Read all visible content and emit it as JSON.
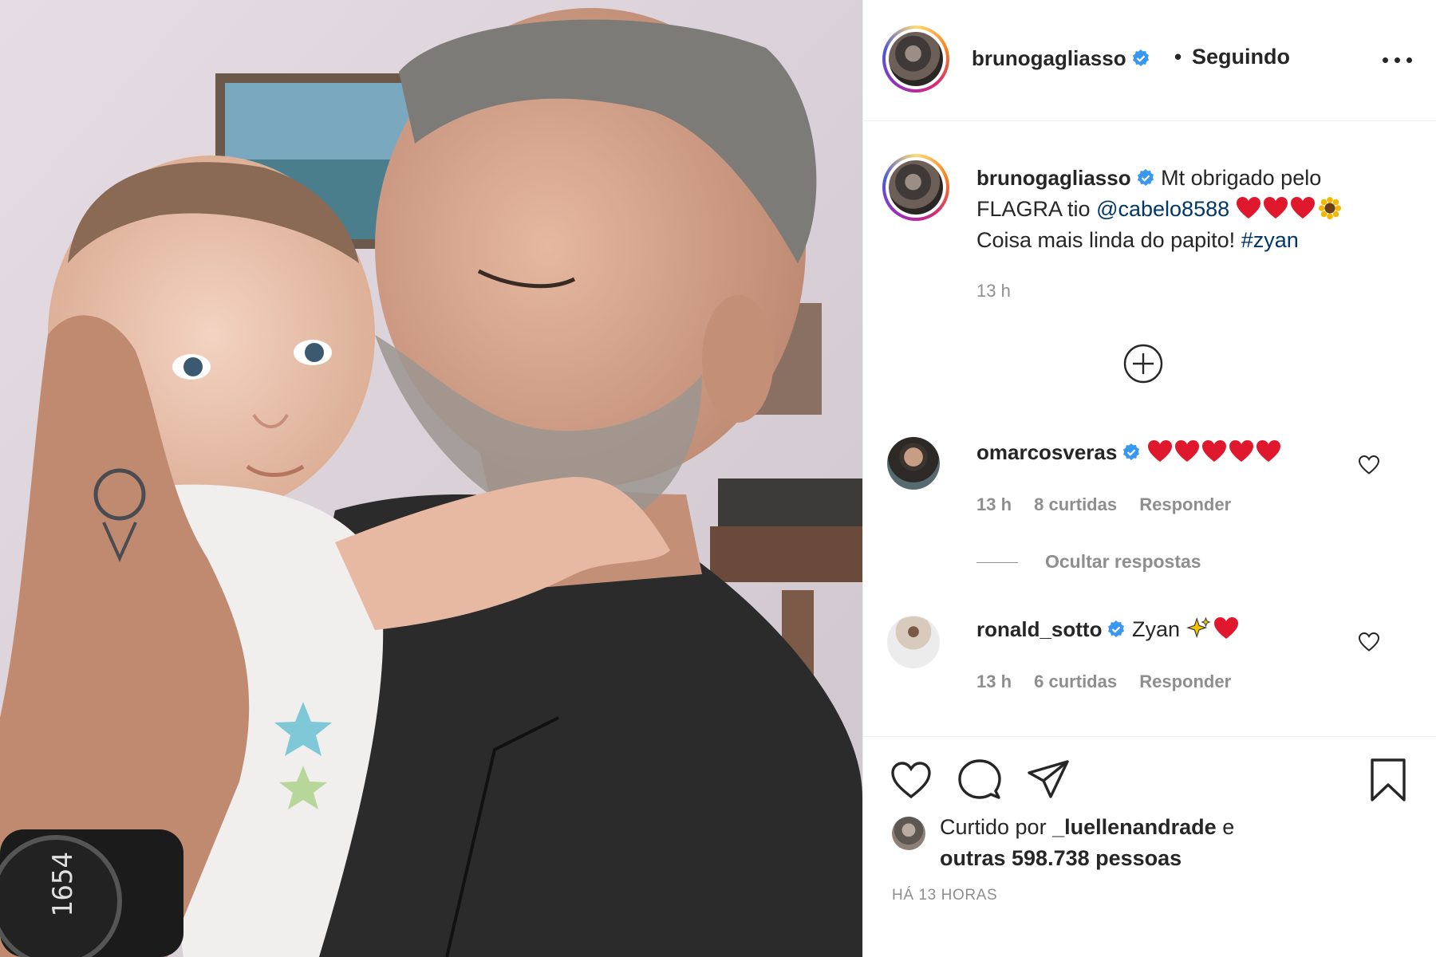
{
  "post": {
    "author": "brunogagliasso",
    "follow_separator": "•",
    "follow_state": "Seguindo",
    "caption": {
      "username": "brunogagliasso",
      "text_line1": "Mt obrigado pelo",
      "text_line2_prefix": "FLAGRA tio",
      "mention": "@cabelo8588",
      "text_line3": "Coisa mais linda do papito!",
      "hashtag": "#zyan",
      "time": "13 h"
    }
  },
  "comments": [
    {
      "username": "omarcosveras",
      "time": "13 h",
      "likes": "8 curtidas",
      "reply": "Responder"
    },
    {
      "username": "ronald_sotto",
      "text": "Zyan",
      "time": "13 h",
      "likes": "6 curtidas",
      "reply": "Responder"
    }
  ],
  "hide_replies": "Ocultar respostas",
  "likes": {
    "prefix": "Curtido por",
    "user": "_luellenandrade",
    "connector": "e",
    "others": "outras 598.738 pessoas"
  },
  "post_time": "HÁ 13 HORAS",
  "colors": {
    "verified_blue": "#3897f0",
    "link_blue": "#00376b",
    "heart_red": "#e0182d",
    "secondary_text": "#8e8e8e"
  },
  "icons": [
    "verified-icon",
    "more-options-icon",
    "load-more-comments-icon",
    "comment-like-icon",
    "like-icon",
    "comment-icon",
    "share-icon",
    "save-icon",
    "heart-emoji",
    "sparkles-emoji",
    "sunflower-emoji"
  ]
}
